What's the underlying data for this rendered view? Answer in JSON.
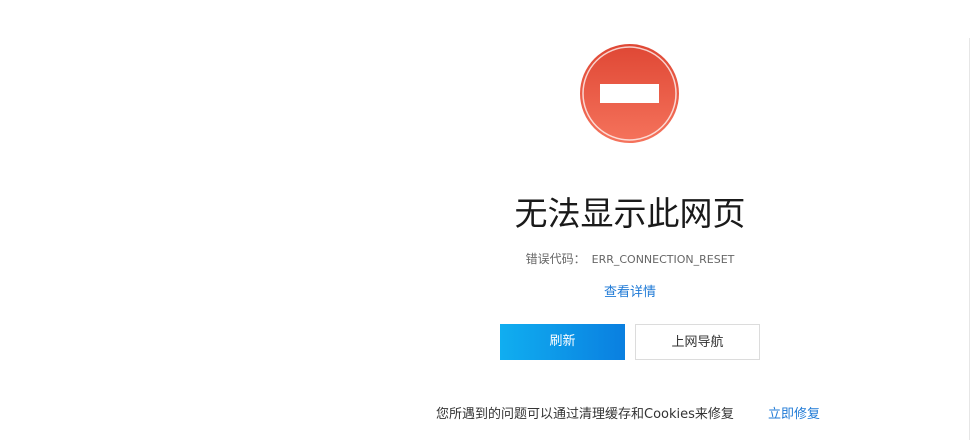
{
  "error_page": {
    "icon": "no-entry-icon",
    "title": "无法显示此网页",
    "error_code_label": "错误代码：",
    "error_code": "ERR_CONNECTION_RESET",
    "details_link": "查看详情",
    "refresh_button": "刷新",
    "nav_button": "上网导航",
    "footer_tip": "您所遇到的问题可以通过清理缓存和Cookies来修复",
    "fix_link": "立即修复"
  },
  "colors": {
    "icon_top": "#e04a35",
    "icon_bottom": "#f4705a",
    "link_blue": "#1f7ad6",
    "button_gradient_start": "#10aef0",
    "button_gradient_end": "#0a7fe0"
  }
}
